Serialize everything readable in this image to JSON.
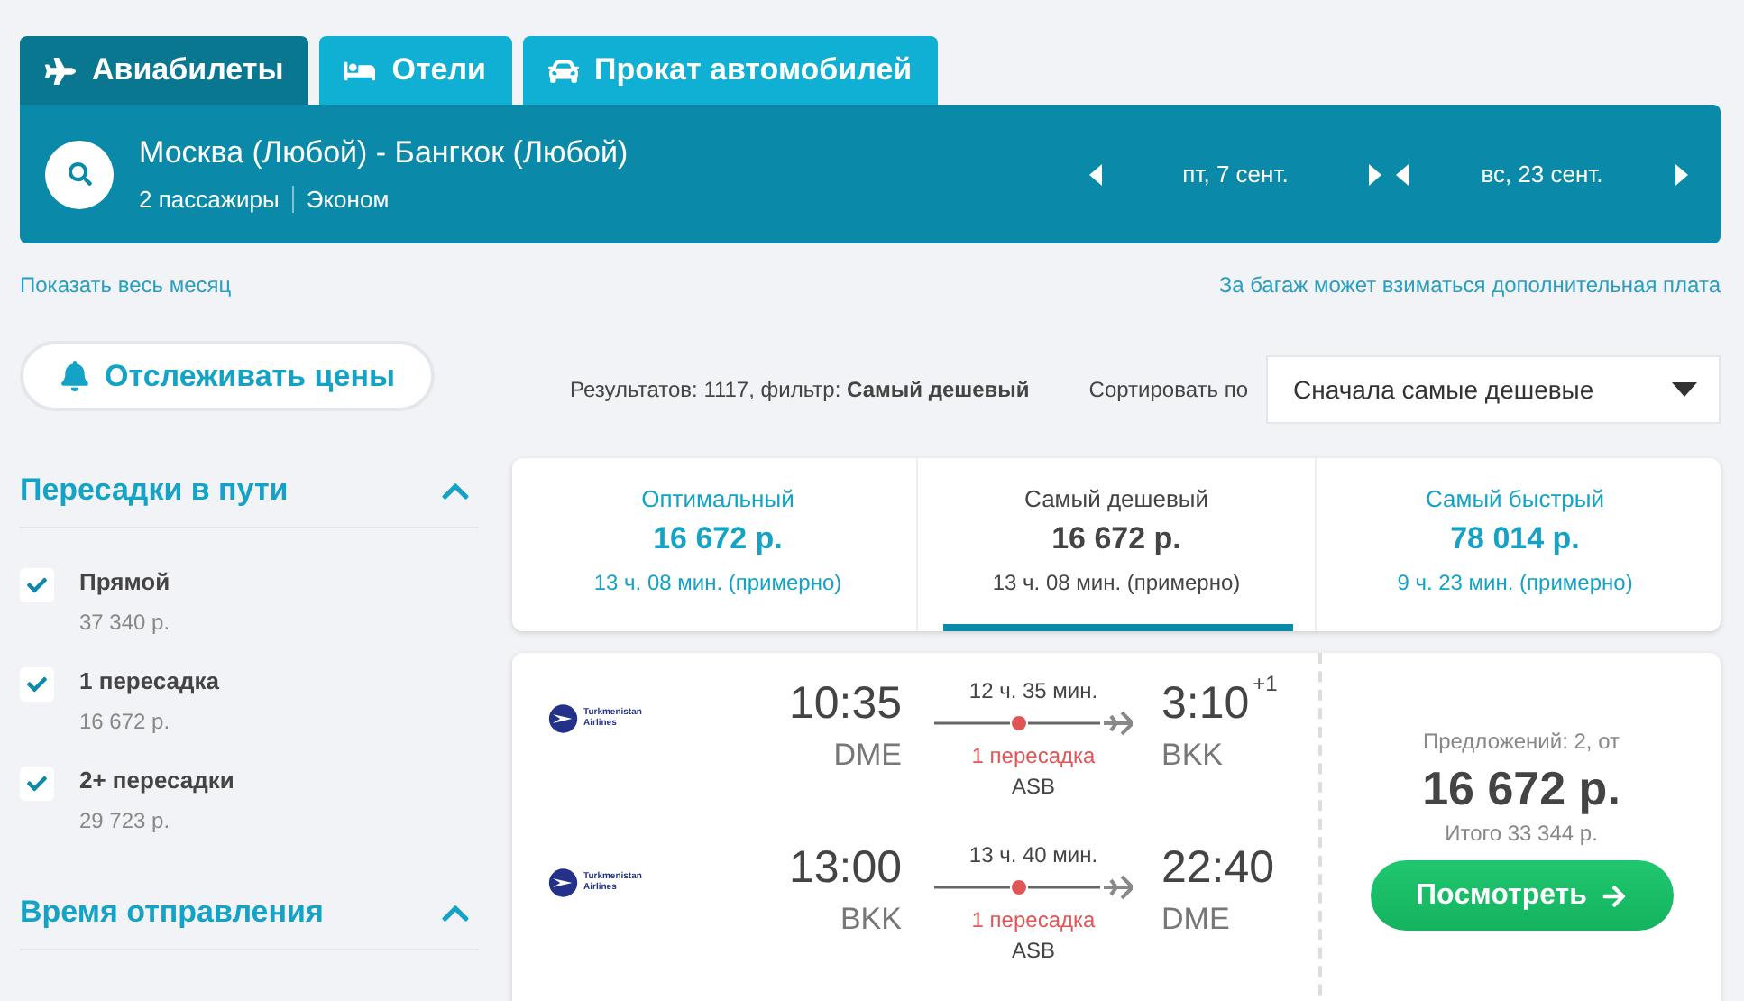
{
  "tabs": [
    {
      "label": "Авиабилеты",
      "kind": "plane",
      "selected": true
    },
    {
      "label": "Отели",
      "kind": "bed",
      "selected": false
    },
    {
      "label": "Прокат автомобилей",
      "kind": "car",
      "selected": false
    }
  ],
  "search": {
    "route": "Москва (Любой) - Бангкок (Любой)",
    "passengers": "2 пассажиры",
    "cabin": "Эконом"
  },
  "dates": [
    {
      "label": "пт, 7 сент."
    },
    {
      "label": "вс, 23 сент."
    }
  ],
  "links": {
    "month": "Показать весь месяц",
    "baggage": "За багаж может взиматься дополнительная плата"
  },
  "track_button": "Отслеживать цены",
  "filters": [
    {
      "title": "Пересадки в пути",
      "expanded": true,
      "options": [
        {
          "label": "Прямой",
          "price": "37 340 р.",
          "checked": true
        },
        {
          "label": "1 пересадка",
          "price": "16 672 р.",
          "checked": true
        },
        {
          "label": "2+ пересадки",
          "price": "29 723 р.",
          "checked": true
        }
      ]
    },
    {
      "title": "Время отправления",
      "expanded": true
    }
  ],
  "results": {
    "text": "Результатов: 1117, фильтр: **Самый дешевый**",
    "sort_label": "Сортировать по",
    "sort_value": "Сначала самые дешевые"
  },
  "summary": [
    {
      "title": "Оптимальный",
      "price": "16 672 р.",
      "duration": "13 ч. 08 мин. (примерно)",
      "selected": false
    },
    {
      "title": "Самый дешевый",
      "price": "16 672 р.",
      "duration": "13 ч. 08 мин. (примерно)",
      "selected": true
    },
    {
      "title": "Самый быстрый",
      "price": "78 014 р.",
      "duration": "9 ч. 23 мин. (примерно)",
      "selected": false
    }
  ],
  "offer": {
    "legs": [
      {
        "airline": "Turkmenistan Airlines",
        "dep_time": "10:35",
        "dep_airport": "DME",
        "duration": "12 ч. 35 мин.",
        "stops": "1 пересадка",
        "via": "ASB",
        "arr_time": "3:10",
        "arr_day_offset": "+1",
        "arr_airport": "BKK"
      },
      {
        "airline": "Turkmenistan Airlines",
        "dep_time": "13:00",
        "dep_airport": "BKK",
        "duration": "13 ч. 40 мин.",
        "stops": "1 пересадка",
        "via": "ASB",
        "arr_time": "22:40",
        "arr_airport": "DME"
      }
    ],
    "offers_text": "Предложений: 2, от",
    "price": "16 672 р.",
    "total": "Итого 33 344 р.",
    "button": "Посмотреть"
  }
}
